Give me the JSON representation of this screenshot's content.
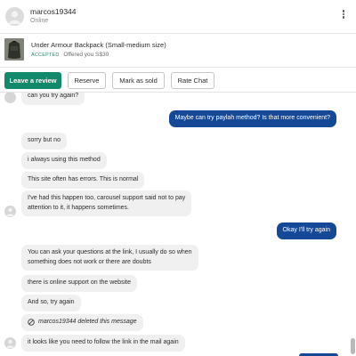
{
  "header": {
    "username": "marcos19344",
    "status": "Online"
  },
  "listing": {
    "title": "Under Armour Backpack (Small-medium size)",
    "badge": "ACCEPTED",
    "offer": "Offered you S$30"
  },
  "actions": {
    "leave_review": "Leave a review",
    "reserve": "Reserve",
    "mark_sold": "Mark as sold",
    "rate_chat": "Rate Chat"
  },
  "messages": {
    "m0": "can you try again?",
    "m1": "Maybe can try paylah method? Is that more convenient?",
    "m2": "sorry but no",
    "m3": "i always using this method",
    "m4": "This site often has errors. This is normal",
    "m5_line1": "I've had this happen too, carousel support said not to pay",
    "m5_line2": "attention to it, it happens sometimes.",
    "m6": "Okay I'll try again",
    "m7_line1": "You can ask your questions at the link, I usually do so when",
    "m7_line2": "something does not work or there are doubts",
    "m8": "there is online support on the website",
    "m9": "And so, try again",
    "m10": "marcos19344 deleted this message",
    "m11": "it looks like you need to follow the link in the mail again"
  },
  "colors": {
    "accent_green": "#13896b",
    "outgoing_bubble": "#154896",
    "incoming_bubble": "#f0f0f1"
  },
  "icons": {
    "kebab": "more-vertical-icon",
    "deleted": "ban-icon"
  }
}
